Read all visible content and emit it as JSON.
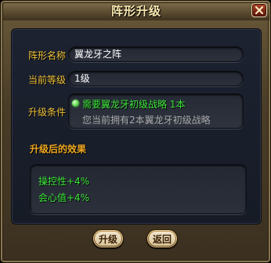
{
  "window": {
    "title": "阵形升级"
  },
  "form": {
    "formation_name_label": "阵形名称",
    "formation_name_value": "翼龙牙之阵",
    "current_level_label": "当前等级",
    "current_level_value": "1级",
    "upgrade_condition_label": "升级条件",
    "condition_requirement": "需要翼龙牙初级战略 1本",
    "condition_owned": "您当前拥有2本翼龙牙初级战略"
  },
  "effects": {
    "title": "升级后的效果",
    "lines": [
      "操控性+4%",
      "会心值+4%"
    ]
  },
  "buttons": {
    "upgrade_label": "升级",
    "back_label": "返回"
  },
  "colors": {
    "label_gold": "#f0c23a",
    "effect_green": "#3ee83a",
    "section_orange": "#f0a820",
    "panel_bg": "#1c2230",
    "frame_brown": "#5a4a30"
  },
  "icons": {
    "close": "close-icon",
    "condition_status": "status-dot-icon"
  }
}
